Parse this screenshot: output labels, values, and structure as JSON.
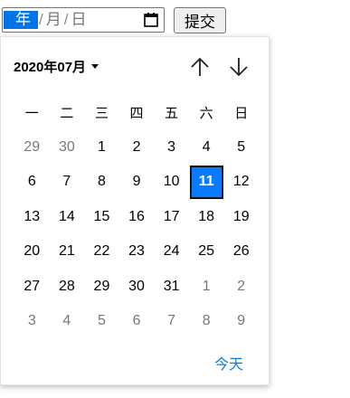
{
  "date_input": {
    "year_placeholder": "年",
    "month_placeholder": "月",
    "day_placeholder": "日",
    "separator": "/",
    "calendar_icon": "calendar-icon"
  },
  "submit_button": {
    "label": "提交"
  },
  "date_picker": {
    "month_label": "2020年07月",
    "dropdown_icon": "caret-down-icon",
    "prev_icon": "arrow-up-icon",
    "next_icon": "arrow-down-icon",
    "weekdays": [
      "一",
      "二",
      "三",
      "四",
      "五",
      "六",
      "日"
    ],
    "weeks": [
      [
        {
          "d": "29",
          "m": true
        },
        {
          "d": "30",
          "m": true
        },
        {
          "d": "1"
        },
        {
          "d": "2"
        },
        {
          "d": "3"
        },
        {
          "d": "4"
        },
        {
          "d": "5"
        }
      ],
      [
        {
          "d": "6"
        },
        {
          "d": "7"
        },
        {
          "d": "8"
        },
        {
          "d": "9"
        },
        {
          "d": "10"
        },
        {
          "d": "11",
          "sel": true
        },
        {
          "d": "12"
        }
      ],
      [
        {
          "d": "13"
        },
        {
          "d": "14"
        },
        {
          "d": "15"
        },
        {
          "d": "16"
        },
        {
          "d": "17"
        },
        {
          "d": "18"
        },
        {
          "d": "19"
        }
      ],
      [
        {
          "d": "20"
        },
        {
          "d": "21"
        },
        {
          "d": "22"
        },
        {
          "d": "23"
        },
        {
          "d": "24"
        },
        {
          "d": "25"
        },
        {
          "d": "26"
        }
      ],
      [
        {
          "d": "27"
        },
        {
          "d": "28"
        },
        {
          "d": "29"
        },
        {
          "d": "30"
        },
        {
          "d": "31"
        },
        {
          "d": "1",
          "m": true
        },
        {
          "d": "2",
          "m": true
        }
      ],
      [
        {
          "d": "3",
          "m": true
        },
        {
          "d": "4",
          "m": true
        },
        {
          "d": "5",
          "m": true
        },
        {
          "d": "6",
          "m": true
        },
        {
          "d": "7",
          "m": true
        },
        {
          "d": "8",
          "m": true
        },
        {
          "d": "9",
          "m": true
        }
      ]
    ],
    "selected_day": "11",
    "today_label": "今天"
  },
  "colors": {
    "selected_bg": "#0a7aff",
    "segment_highlight": "#0074e8",
    "link": "#0c7cd5",
    "muted_day": "#777777"
  }
}
